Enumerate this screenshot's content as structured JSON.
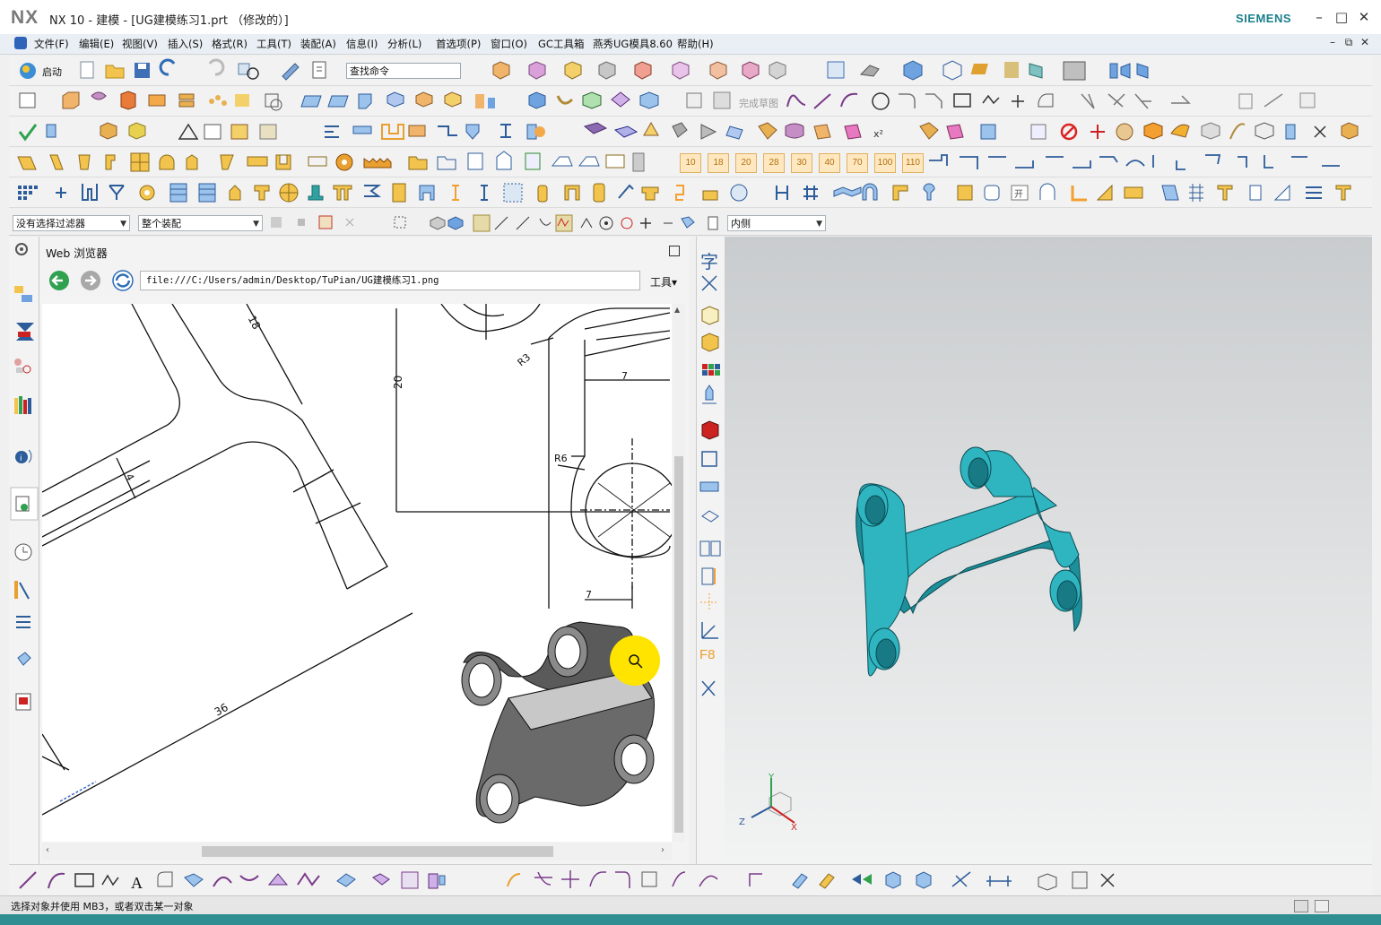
{
  "app": {
    "logo": "NX",
    "title": "NX 10 - 建模 - [UG建模练习1.prt （修改的）]",
    "brand": "SIEMENS",
    "window_controls": [
      "–",
      "□",
      "✕"
    ],
    "inner_controls": [
      "–",
      "⧉",
      "✕"
    ]
  },
  "menu": {
    "items": [
      "文件(F)",
      "编辑(E)",
      "视图(V)",
      "插入(S)",
      "格式(R)",
      "工具(T)",
      "装配(A)",
      "信息(I)",
      "分析(L)",
      "首选项(P)",
      "窗口(O)",
      "GC工具箱",
      "燕秀UG模具8.60",
      "帮助(H)"
    ]
  },
  "toolbar": {
    "start_label": "启动",
    "search_placeholder": "查找命令",
    "finish_sketch": "完成草图",
    "multiplier_buttons": [
      "10",
      "18",
      "20",
      "28",
      "30",
      "40",
      "70",
      "100",
      "110"
    ]
  },
  "selection": {
    "filter": "没有选择过滤器",
    "scope": "整个装配",
    "side": "内侧"
  },
  "browser": {
    "title": "Web 浏览器",
    "url": "file:///C:/Users/admin/Desktop/TuPian/UG建模练习1.png",
    "tools_label": "工具",
    "dimensions": [
      "18",
      "20",
      "R3",
      "7",
      "4",
      "R6",
      "7",
      "36"
    ]
  },
  "midbar": {
    "labels": [
      "字",
      "F8"
    ]
  },
  "viewport": {
    "triad_labels": [
      "Y",
      "Z",
      "X"
    ],
    "part_color": "#2fa9b4"
  },
  "status": {
    "text": "选择对象并使用 MB3，或者双击某一对象"
  },
  "colors": {
    "window_border": "#2e8e92",
    "accent": "#1a7f8c",
    "highlight": "#ffe400"
  }
}
